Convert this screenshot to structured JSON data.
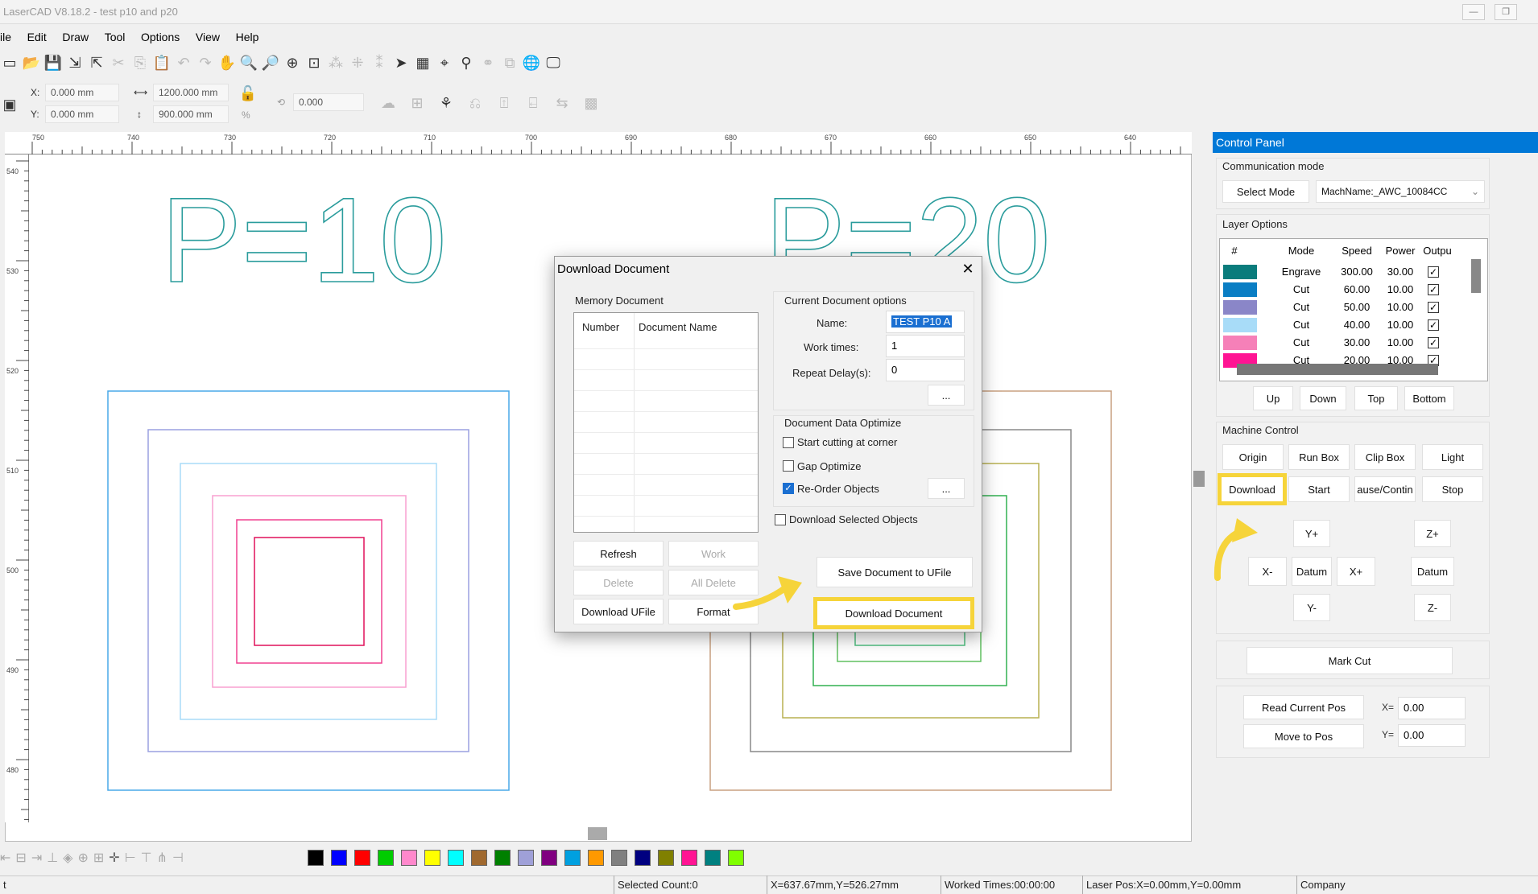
{
  "window": {
    "title": "LaserCAD V8.18.2 - test p10 and p20"
  },
  "menu": [
    "ile",
    "Edit",
    "Draw",
    "Tool",
    "Options",
    "View",
    "Help"
  ],
  "coords": {
    "x_label": "X:",
    "x_value": "0.000 mm",
    "y_label": "Y:",
    "y_value": "0.000 mm",
    "width_value": "1200.000 mm",
    "height_value": "900.000 mm",
    "rotate_value": "0.000",
    "percent_symbol": "%"
  },
  "ruler": {
    "top_labels": [
      "750",
      "740",
      "730",
      "720",
      "710",
      "700",
      "690",
      "680",
      "670",
      "660",
      "650",
      "640"
    ],
    "left_labels": [
      "540",
      "530",
      "520",
      "510",
      "500",
      "490",
      "480"
    ]
  },
  "canvas": {
    "text_left": "P=10",
    "text_right": "P=20"
  },
  "palette": [
    "#000000",
    "#0000ff",
    "#ff0000",
    "#00cc00",
    "#ff88cc",
    "#ffff00",
    "#00ffff",
    "#a0692f",
    "#008000",
    "#9fa0d8",
    "#800080",
    "#00a0e0",
    "#ff9900",
    "#808080",
    "#000080",
    "#808000",
    "#ff1493",
    "#008080",
    "#80ff00"
  ],
  "status": {
    "cell0": "t",
    "selected": "Selected Count:0",
    "pos": "X=637.67mm,Y=526.27mm",
    "worked": "Worked Times:00:00:00",
    "laser": "Laser Pos:X=0.00mm,Y=0.00mm",
    "company": "Company"
  },
  "control_panel": {
    "title": "Control Panel",
    "comm_title": "Communication mode",
    "select_mode": "Select Mode",
    "machine_name": "MachName:_AWC_10084CC",
    "layer_title": "Layer Options",
    "layer_headers": [
      "#",
      "Mode",
      "Speed",
      "Power",
      "Outpu"
    ],
    "layers": [
      {
        "color": "#0a7c7c",
        "mode": "Engrave",
        "speed": "300.00",
        "power": "30.00",
        "out": "✓"
      },
      {
        "color": "#0a7ec4",
        "mode": "Cut",
        "speed": "60.00",
        "power": "10.00",
        "out": "✓"
      },
      {
        "color": "#8a86c8",
        "mode": "Cut",
        "speed": "50.00",
        "power": "10.00",
        "out": "✓"
      },
      {
        "color": "#a8dcf8",
        "mode": "Cut",
        "speed": "40.00",
        "power": "10.00",
        "out": "✓"
      },
      {
        "color": "#f680b8",
        "mode": "Cut",
        "speed": "30.00",
        "power": "10.00",
        "out": "✓"
      },
      {
        "color": "#ff1493",
        "mode": "Cut",
        "speed": "20.00",
        "power": "10.00",
        "out": "✓"
      }
    ],
    "layer_buttons": [
      "Up",
      "Down",
      "Top",
      "Bottom"
    ],
    "machine_title": "Machine Control",
    "machine_row1": [
      "Origin",
      "Run Box",
      "Clip Box",
      "Light"
    ],
    "machine_row2": [
      "Download",
      "Start",
      "ause/Contin",
      "Stop"
    ],
    "jog": {
      "y_plus": "Y+",
      "x_minus": "X-",
      "datum": "Datum",
      "x_plus": "X+",
      "y_minus": "Y-",
      "z_plus": "Z+",
      "z_datum": "Datum",
      "z_minus": "Z-"
    },
    "mark_cut": "Mark Cut",
    "read_pos": "Read Current Pos",
    "move_pos": "Move to Pos",
    "x_label": "X=",
    "x_value": "0.00",
    "y_label": "Y=",
    "y_value": "0.00"
  },
  "dialog": {
    "title": "Download Document",
    "memory_title": "Memory Document",
    "col_number": "Number",
    "col_name": "Document Name",
    "options_title": "Current Document options",
    "name_label": "Name:",
    "name_value": "TEST P10 A",
    "work_times_label": "Work times:",
    "work_times_value": "1",
    "repeat_label": "Repeat Delay(s):",
    "repeat_value": "0",
    "more": "...",
    "optimize_title": "Document Data Optimize",
    "opt_corner": "Start cutting at corner",
    "opt_gap": "Gap Optimize",
    "opt_reorder": "Re-Order Objects",
    "download_selected": "Download Selected Objects",
    "btn_refresh": "Refresh",
    "btn_work": "Work",
    "btn_delete": "Delete",
    "btn_all_delete": "All Delete",
    "btn_download_ufile": "Download UFile",
    "btn_format": "Format",
    "btn_save_ufile": "Save Document to UFile",
    "btn_download_doc": "Download Document",
    "close": "✕"
  },
  "colors": {
    "accent": "#0078d7",
    "highlight": "#f6d43a"
  }
}
